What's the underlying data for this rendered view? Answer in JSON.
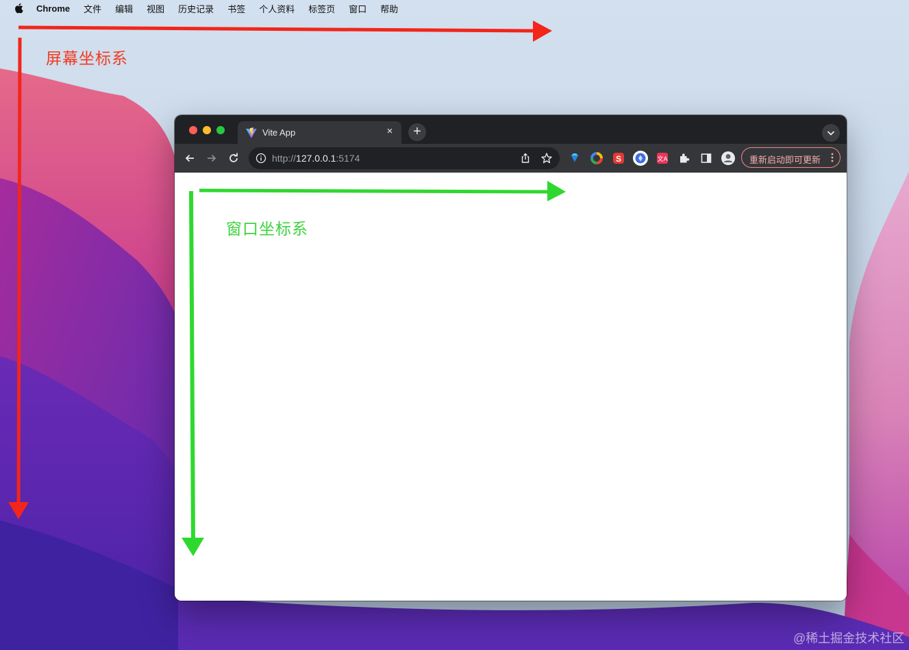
{
  "menubar": {
    "app_name": "Chrome",
    "items": [
      "文件",
      "编辑",
      "视图",
      "历史记录",
      "书签",
      "个人资料",
      "标签页",
      "窗口",
      "帮助"
    ]
  },
  "annotations": {
    "screen_label": "屏幕坐标系",
    "window_label": "窗口坐标系",
    "screen_color": "#f23a1d",
    "window_color": "#3dd23d"
  },
  "browser": {
    "tab_title": "Vite App",
    "tab_close": "×",
    "new_tab": "+",
    "url_scheme": "http://",
    "url_host": "127.0.0.1",
    "url_port": ":5174",
    "update_button": "重新启动即可更新"
  },
  "watermark": "@稀土掘金技术社区"
}
